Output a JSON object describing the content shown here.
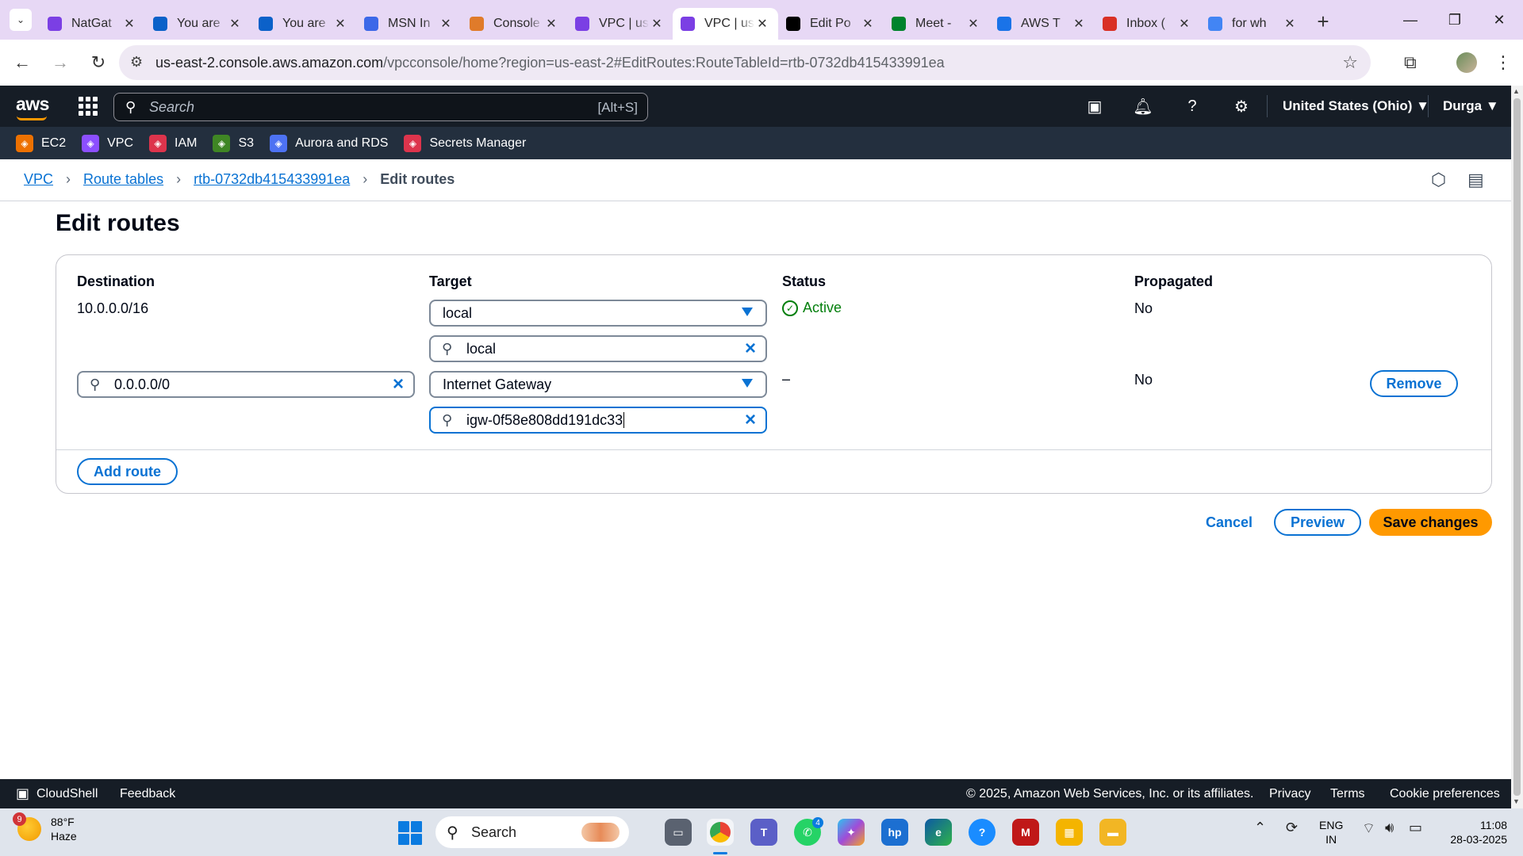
{
  "browser": {
    "tabs": [
      {
        "label": "NatGat",
        "favicon": "aws-vpc-icon",
        "color": "#7b3fe4"
      },
      {
        "label": "You are",
        "favicon": "s-icon",
        "color": "#0b61c9"
      },
      {
        "label": "You are",
        "favicon": "s-icon",
        "color": "#0b61c9"
      },
      {
        "label": "MSN In",
        "favicon": "msn-butterfly-icon",
        "color": "#3c68e8"
      },
      {
        "label": "Console",
        "favicon": "aws-console-icon",
        "color": "#e07b2a"
      },
      {
        "label": "VPC | us",
        "favicon": "aws-vpc-icon",
        "color": "#7b3fe4"
      },
      {
        "label": "VPC | us",
        "favicon": "aws-vpc-icon",
        "color": "#7b3fe4",
        "active": true
      },
      {
        "label": "Edit Po",
        "favicon": "dev-icon",
        "color": "#000000"
      },
      {
        "label": "Meet -",
        "favicon": "google-meet-icon",
        "color": "#00832d"
      },
      {
        "label": "AWS T",
        "favicon": "aws-t-icon",
        "color": "#1a73e8"
      },
      {
        "label": "Inbox (",
        "favicon": "gmail-icon",
        "color": "#d93025"
      },
      {
        "label": "for wh",
        "favicon": "google-icon",
        "color": "#4285f4"
      }
    ],
    "new_tab": "+",
    "url_host": "us-east-2.console.aws.amazon.com",
    "url_rest": "/vpcconsole/home?region=us-east-2#EditRoutes:RouteTableId=rtb-0732db415433991ea"
  },
  "aws_header": {
    "logo": "aws",
    "search_placeholder": "Search",
    "search_shortcut": "[Alt+S]",
    "region": "United States (Ohio) ▼",
    "user": "Durga ▼",
    "favorites": [
      {
        "label": "EC2",
        "icon": "ec2-icon",
        "color": "#ed7100"
      },
      {
        "label": "VPC",
        "icon": "vpc-icon",
        "color": "#8c4fff"
      },
      {
        "label": "IAM",
        "icon": "iam-icon",
        "color": "#dd344c"
      },
      {
        "label": "S3",
        "icon": "s3-icon",
        "color": "#3f8624"
      },
      {
        "label": "Aurora and RDS",
        "icon": "rds-icon",
        "color": "#4d72f3"
      },
      {
        "label": "Secrets Manager",
        "icon": "secrets-manager-icon",
        "color": "#dd344c"
      }
    ]
  },
  "breadcrumb": {
    "items": [
      "VPC",
      "Route tables",
      "rtb-0732db415433991ea"
    ],
    "current": "Edit routes"
  },
  "page": {
    "title": "Edit routes",
    "columns": {
      "destination": "Destination",
      "target": "Target",
      "status": "Status",
      "propagated": "Propagated"
    },
    "routes": [
      {
        "destination": "10.0.0.0/16",
        "target_type": "local",
        "target_value": "local",
        "status": "Active",
        "propagated": "No"
      },
      {
        "destination": "0.0.0.0/0",
        "target_type": "Internet Gateway",
        "target_value": "igw-0f58e808dd191dc33",
        "status": "–",
        "propagated": "No",
        "remove_label": "Remove"
      }
    ],
    "add_route_label": "Add route",
    "cancel_label": "Cancel",
    "preview_label": "Preview",
    "save_label": "Save changes"
  },
  "footer": {
    "cloudshell": "CloudShell",
    "feedback": "Feedback",
    "copyright": "© 2025, Amazon Web Services, Inc. or its affiliates.",
    "privacy": "Privacy",
    "terms": "Terms",
    "cookies": "Cookie preferences"
  },
  "taskbar": {
    "weather_temp": "88°F",
    "weather_desc": "Haze",
    "weather_badge": "9",
    "search_label": "Search",
    "teams_badge": "4",
    "lang_1": "ENG",
    "lang_2": "IN",
    "time": "11:08",
    "date": "28-03-2025"
  }
}
